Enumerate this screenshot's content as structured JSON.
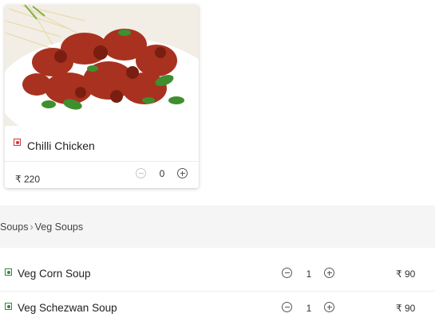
{
  "card": {
    "title": "Chilli Chicken",
    "price": "₹ 220",
    "quantity": "0",
    "image_icon": "chilli-chicken-photo",
    "type_icon": "nonveg-icon"
  },
  "breadcrumb": {
    "category": "Soups",
    "separator": "›",
    "subcategory": "Veg Soups"
  },
  "items": [
    {
      "name": "Veg Corn Soup",
      "quantity": "1",
      "price": "₹ 90",
      "type_icon": "veg-icon"
    },
    {
      "name": "Veg Schezwan Soup",
      "quantity": "1",
      "price": "₹ 90",
      "type_icon": "veg-icon"
    }
  ],
  "colors": {
    "nonveg": "#d3353a",
    "veg": "#2e8b3a",
    "section_bg": "#f5f5f5"
  }
}
